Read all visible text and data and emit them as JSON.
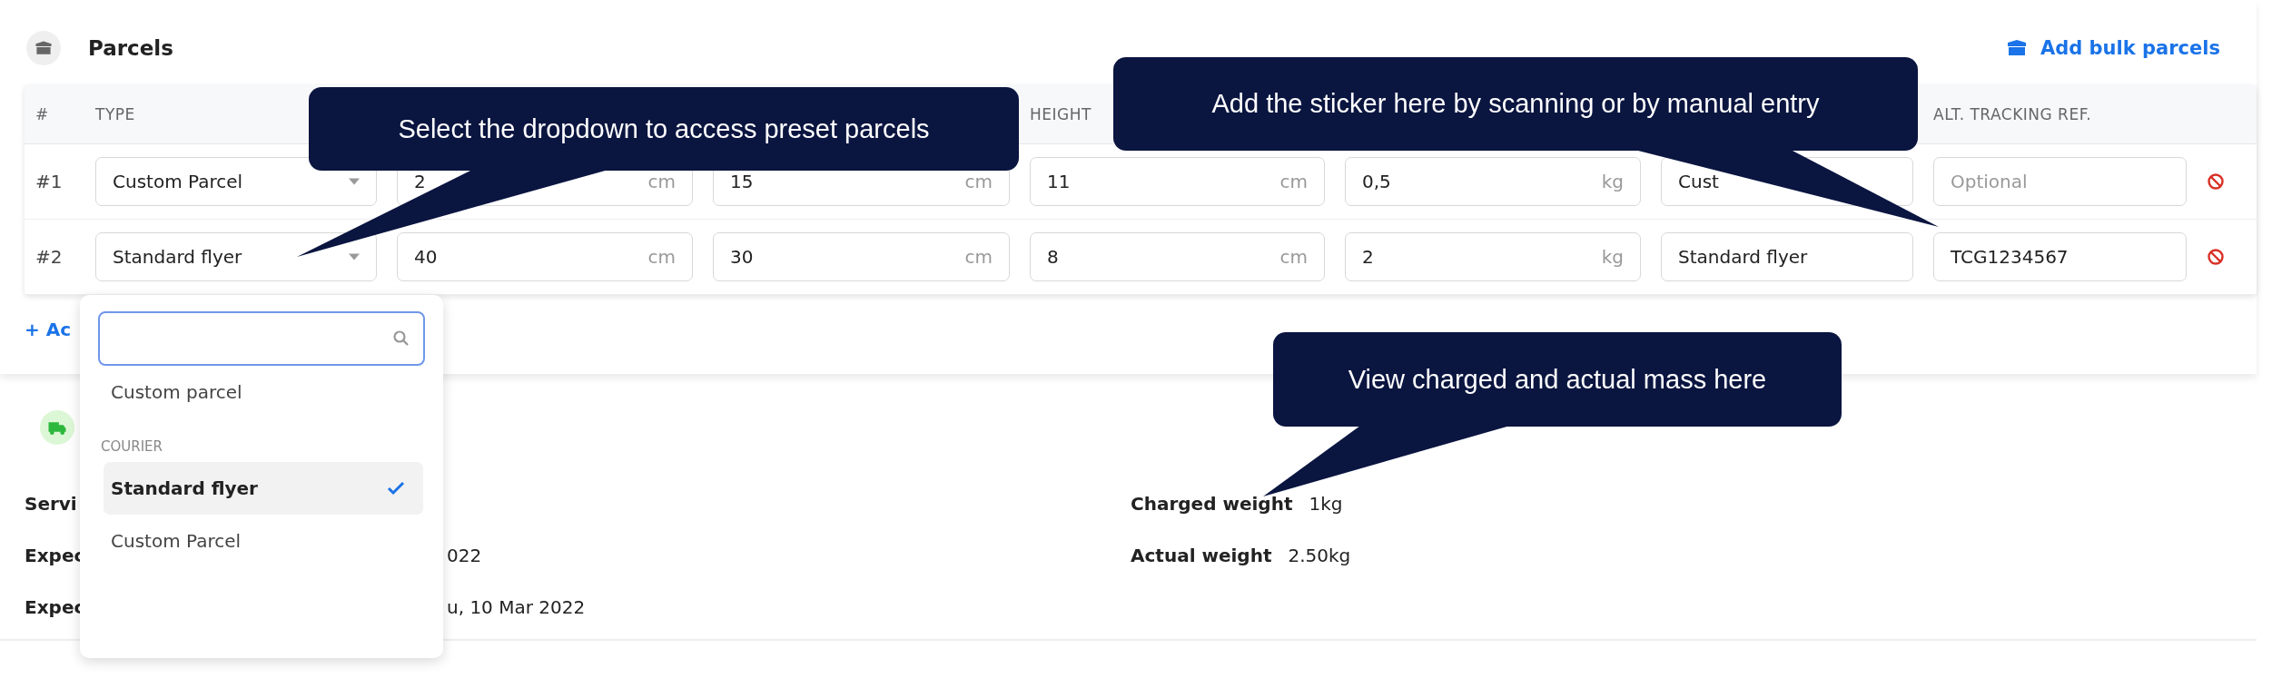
{
  "parcels": {
    "title": "Parcels",
    "bulk_link": "Add bulk parcels",
    "add_link": "+ Ac",
    "columns": [
      {
        "label": "#"
      },
      {
        "label": "TYPE"
      },
      {},
      {},
      {
        "label": "HEIGHT"
      },
      {},
      {},
      {
        "label": "ALT. TRACKING REF."
      },
      {}
    ],
    "rows": [
      {
        "index": "#1",
        "type": "Custom Parcel",
        "length": {
          "value": "2",
          "unit": "cm"
        },
        "width": {
          "value": "15",
          "unit": "cm"
        },
        "height": {
          "value": "11",
          "unit": "cm"
        },
        "weight": {
          "value": "0,5",
          "unit": "kg"
        },
        "description": "Cust",
        "alt_ref": {
          "placeholder": "Optional"
        }
      },
      {
        "index": "#2",
        "type": "Standard flyer",
        "length": {
          "value": "40",
          "unit": "cm"
        },
        "width": {
          "value": "30",
          "unit": "cm"
        },
        "height": {
          "value": "8",
          "unit": "cm"
        },
        "weight": {
          "value": "2",
          "unit": "kg"
        },
        "description": "Standard flyer",
        "alt_ref": {
          "value": "TCG1234567"
        }
      }
    ]
  },
  "dropdown": {
    "search": {
      "focused": true
    },
    "items": [
      {
        "kind": "option",
        "label": "Custom parcel",
        "selected": false
      },
      {
        "kind": "group",
        "label": "COURIER"
      },
      {
        "kind": "option",
        "label": "Standard flyer",
        "selected": true
      },
      {
        "kind": "option",
        "label": "Custom Parcel",
        "selected": false
      }
    ]
  },
  "shipment": {
    "left": [
      {
        "label": "Servi"
      },
      {
        "label": "Expec",
        "value": "022"
      },
      {
        "label": "Expec",
        "value": "u, 10 Mar 2022"
      }
    ],
    "right": [
      {
        "label": "Charged weight",
        "value": "1kg"
      },
      {
        "label": "Actual weight",
        "value": "2.50kg"
      }
    ]
  },
  "callouts": [
    {
      "text": "Select the dropdown to access preset parcels"
    },
    {
      "text": "Add the sticker here by scanning or by manual entry"
    },
    {
      "text": "View charged and actual mass here"
    }
  ]
}
